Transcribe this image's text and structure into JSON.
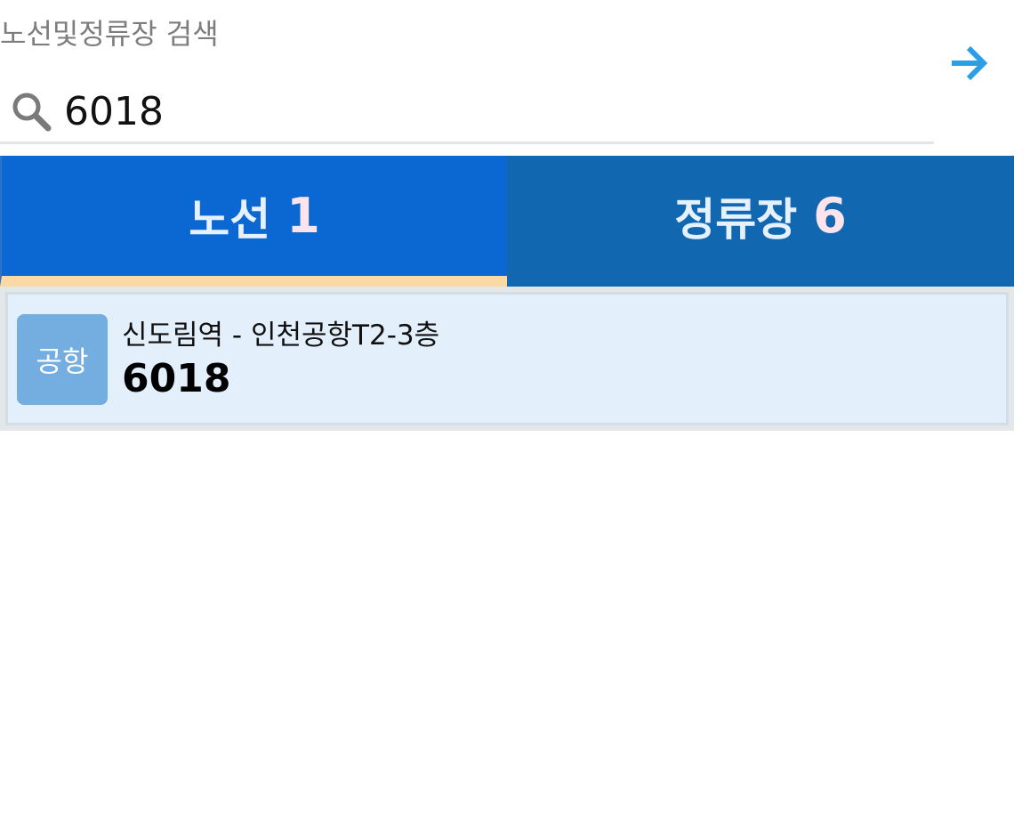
{
  "search": {
    "label": "노선및정류장 검색",
    "value": "6018"
  },
  "tabs": [
    {
      "label": "노선",
      "count": "1",
      "selected": true
    },
    {
      "label": "정류장",
      "count": "6",
      "selected": false
    }
  ],
  "results": [
    {
      "type": "공항",
      "description": "신도림역 - 인천공항T2-3층",
      "number": "6018"
    }
  ],
  "icons": {
    "search": "search-icon",
    "go": "arrow-right-icon"
  },
  "colors": {
    "tab_selected": "#0b67d2",
    "tab_unselected": "#1268b0",
    "tab_indicator": "#fbd9a5",
    "badge": "#74addf",
    "arrow": "#2a9fe8"
  }
}
